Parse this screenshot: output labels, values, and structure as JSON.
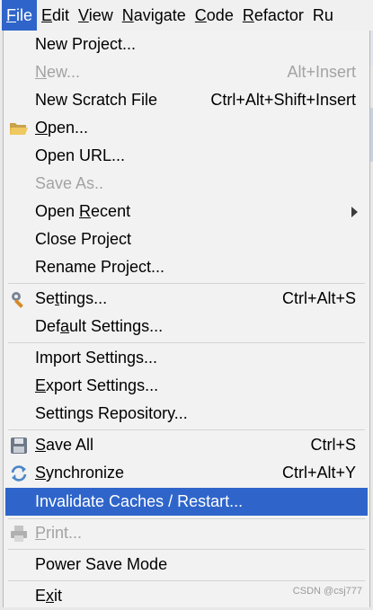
{
  "menubar": {
    "items": [
      {
        "mnemonic": "F",
        "rest": "ile"
      },
      {
        "mnemonic": "E",
        "rest": "dit"
      },
      {
        "mnemonic": "V",
        "rest": "iew"
      },
      {
        "mnemonic": "N",
        "rest": "avigate"
      },
      {
        "mnemonic": "C",
        "rest": "ode"
      },
      {
        "mnemonic": "R",
        "rest": "efactor"
      },
      {
        "mnemonic": "",
        "rest": "Ru"
      }
    ]
  },
  "menu": {
    "new_project": "New Project...",
    "new_pre": "",
    "new_mn": "N",
    "new_post": "ew...",
    "new_shortcut": "Alt+Insert",
    "new_scratch": "New Scratch File",
    "new_scratch_shortcut": "Ctrl+Alt+Shift+Insert",
    "open_pre": "",
    "open_mn": "O",
    "open_post": "pen...",
    "open_url": "Open URL...",
    "save_as": "Save As..",
    "open_recent_pre": "Open ",
    "open_recent_mn": "R",
    "open_recent_post": "ecent",
    "close_project_pre": "Close Pro",
    "close_project_mn": "j",
    "close_project_post": "ect",
    "rename_project": "Rename Project...",
    "settings_pre": "Se",
    "settings_mn": "t",
    "settings_post": "tings...",
    "settings_shortcut": "Ctrl+Alt+S",
    "default_settings_pre": "Def",
    "default_settings_mn": "a",
    "default_settings_post": "ult Settings...",
    "import_settings": "Import Settings...",
    "export_settings_pre": "",
    "export_settings_mn": "E",
    "export_settings_post": "xport Settings...",
    "settings_repository": "Settings Repository...",
    "save_all_pre": "",
    "save_all_mn": "S",
    "save_all_post": "ave All",
    "save_all_shortcut": "Ctrl+S",
    "synchronize_pre": "",
    "synchronize_mn": "S",
    "synchronize_post": "ynchronize",
    "synchronize_shortcut": "Ctrl+Alt+Y",
    "invalidate_caches": "Invalidate Caches / Restart...",
    "print_pre": "",
    "print_mn": "P",
    "print_post": "rint...",
    "power_save_mode": "Power Save Mode",
    "exit_pre": "E",
    "exit_mn": "x",
    "exit_post": "it"
  },
  "colors": {
    "highlight": "#2f65ca",
    "menu_bg": "#f2f2f2",
    "disabled_text": "#a3a3a3"
  },
  "watermark": "CSDN @csj777"
}
